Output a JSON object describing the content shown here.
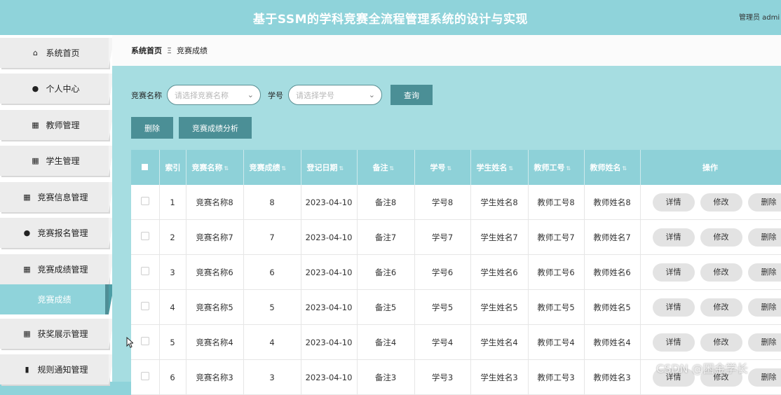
{
  "header": {
    "title": "基于SSM的学科竞赛全流程管理系统的设计与实现",
    "user": "管理员 admi"
  },
  "sidebar": {
    "items": [
      {
        "label": "系统首页",
        "icon": "home-icon",
        "glyph": "⌂"
      },
      {
        "label": "个人中心",
        "icon": "person-icon",
        "glyph": "👤"
      },
      {
        "label": "教师管理",
        "icon": "grid-icon",
        "glyph": "▦"
      },
      {
        "label": "学生管理",
        "icon": "grid-icon",
        "glyph": "▦"
      },
      {
        "label": "竞赛信息管理",
        "icon": "grid-icon",
        "glyph": "▦"
      },
      {
        "label": "竞赛报名管理",
        "icon": "bulb-icon",
        "glyph": "●"
      },
      {
        "label": "竞赛成绩管理",
        "icon": "grid-icon",
        "glyph": "▦"
      },
      {
        "label": "竞赛成绩",
        "icon": "",
        "glyph": ""
      },
      {
        "label": "获奖展示管理",
        "icon": "grid-icon",
        "glyph": "▦"
      },
      {
        "label": "规则通知管理",
        "icon": "bar-chart-icon",
        "glyph": "▮"
      }
    ]
  },
  "breadcrumb": {
    "home": "系统首页",
    "sep": "Ξ",
    "current": "竞赛成绩"
  },
  "filter": {
    "name_label": "竞赛名称",
    "name_placeholder": "请选择竞赛名称",
    "id_label": "学号",
    "id_placeholder": "请选择学号",
    "search_button": "查询"
  },
  "actions": {
    "delete": "删除",
    "analysis": "竞赛成绩分析"
  },
  "table": {
    "columns": [
      "索引",
      "竞赛名称",
      "竞赛成绩",
      "登记日期",
      "备注",
      "学号",
      "学生姓名",
      "教师工号",
      "教师姓名",
      "操作"
    ],
    "rows": [
      [
        "1",
        "竞赛名称8",
        "8",
        "2023-04-10",
        "备注8",
        "学号8",
        "学生姓名8",
        "教师工号8",
        "教师姓名8"
      ],
      [
        "2",
        "竞赛名称7",
        "7",
        "2023-04-10",
        "备注7",
        "学号7",
        "学生姓名7",
        "教师工号7",
        "教师姓名7"
      ],
      [
        "3",
        "竞赛名称6",
        "6",
        "2023-04-10",
        "备注6",
        "学号6",
        "学生姓名6",
        "教师工号6",
        "教师姓名6"
      ],
      [
        "4",
        "竞赛名称5",
        "5",
        "2023-04-10",
        "备注5",
        "学号5",
        "学生姓名5",
        "教师工号5",
        "教师姓名5"
      ],
      [
        "5",
        "竞赛名称4",
        "4",
        "2023-04-10",
        "备注4",
        "学号4",
        "学生姓名4",
        "教师工号4",
        "教师姓名4"
      ],
      [
        "6",
        "竞赛名称3",
        "3",
        "2023-04-10",
        "备注3",
        "学号3",
        "学生姓名3",
        "教师工号3",
        "教师姓名3"
      ]
    ],
    "row_buttons": [
      "详情",
      "修改",
      "删除"
    ]
  },
  "watermark": "CSDN @困金学长",
  "colors": {
    "accent": "#8fd3da",
    "button": "#4b8f96"
  }
}
